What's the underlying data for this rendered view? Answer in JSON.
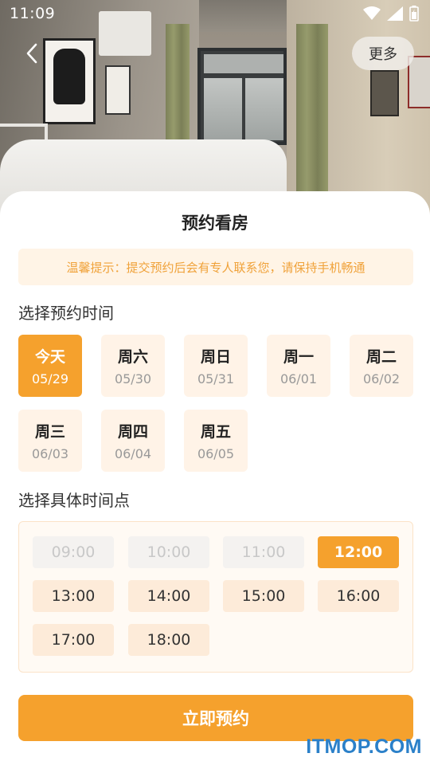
{
  "status_bar": {
    "time": "11:09"
  },
  "header": {
    "more_label": "更多"
  },
  "sheet": {
    "title": "预约看房",
    "tip": "温馨提示：提交预约后会有专人联系您，请保持手机畅通",
    "date_section_label": "选择预约时间",
    "days": [
      {
        "weekday": "今天",
        "date": "05/29",
        "selected": true
      },
      {
        "weekday": "周六",
        "date": "05/30",
        "selected": false
      },
      {
        "weekday": "周日",
        "date": "05/31",
        "selected": false
      },
      {
        "weekday": "周一",
        "date": "06/01",
        "selected": false
      },
      {
        "weekday": "周二",
        "date": "06/02",
        "selected": false
      },
      {
        "weekday": "周三",
        "date": "06/03",
        "selected": false
      },
      {
        "weekday": "周四",
        "date": "06/04",
        "selected": false
      },
      {
        "weekday": "周五",
        "date": "06/05",
        "selected": false
      }
    ],
    "time_section_label": "选择具体时间点",
    "time_slots": [
      {
        "label": "09:00",
        "state": "disabled"
      },
      {
        "label": "10:00",
        "state": "disabled"
      },
      {
        "label": "11:00",
        "state": "disabled"
      },
      {
        "label": "12:00",
        "state": "selected"
      },
      {
        "label": "13:00",
        "state": "available"
      },
      {
        "label": "14:00",
        "state": "available"
      },
      {
        "label": "15:00",
        "state": "available"
      },
      {
        "label": "16:00",
        "state": "available"
      },
      {
        "label": "17:00",
        "state": "available"
      },
      {
        "label": "18:00",
        "state": "available"
      }
    ],
    "submit_label": "立即预约"
  },
  "watermark": "ITMOP.COM",
  "icons": {
    "back": "chevron-left-icon",
    "wifi": "wifi-icon",
    "signal": "signal-icon",
    "battery": "battery-icon"
  },
  "colors": {
    "accent": "#f5a12d",
    "tip_text": "#f0a23a",
    "tip_background": "#fff4e6",
    "option_background": "#fdebd9",
    "disabled_background": "#f4f2f0",
    "watermark": "#2b80c9"
  }
}
